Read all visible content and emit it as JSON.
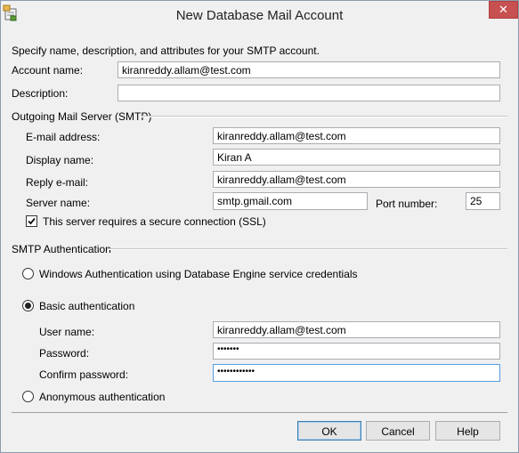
{
  "window": {
    "title": "New Database Mail Account"
  },
  "intro": "Specify name, description, and attributes for your SMTP account.",
  "account": {
    "name_label": "Account name:",
    "name_value": "kiranreddy.allam@test.com",
    "description_label": "Description:",
    "description_value": ""
  },
  "smtp": {
    "group_label": "Outgoing Mail Server (SMTP)",
    "email_label": "E-mail address:",
    "email_value": "kiranreddy.allam@test.com",
    "display_label": "Display name:",
    "display_value": "Kiran A",
    "reply_label": "Reply e-mail:",
    "reply_value": "kiranreddy.allam@test.com",
    "server_label": "Server name:",
    "server_value": "smtp.gmail.com",
    "port_label": "Port number:",
    "port_value": "25",
    "ssl_label": "This server requires a secure connection (SSL)",
    "ssl_checked": true
  },
  "auth": {
    "group_label": "SMTP Authentication",
    "windows_label": "Windows Authentication using Database Engine service credentials",
    "basic_label": "Basic authentication",
    "selected": "basic",
    "user_label": "User name:",
    "user_value": "kiranreddy.allam@test.com",
    "password_label": "Password:",
    "password_value": "•••••••",
    "confirm_label": "Confirm password:",
    "confirm_value": "••••••••••••",
    "anonymous_label": "Anonymous authentication"
  },
  "buttons": {
    "ok": "OK",
    "cancel": "Cancel",
    "help": "Help"
  }
}
